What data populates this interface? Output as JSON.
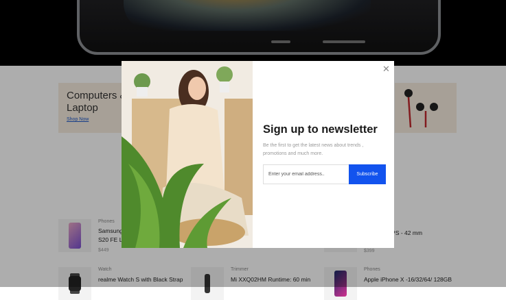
{
  "promo": {
    "title": "Computers & Laptop",
    "link": "Shop Now"
  },
  "products": [
    {
      "category": "Phones",
      "name": "Samsung Galaxy S20 FE Lavender",
      "price": "$449",
      "icon": "phone-image"
    },
    {
      "category": "",
      "name": "Series 3 GPS - 42 mm Aluminium",
      "price": "$399",
      "icon": "watch-image"
    },
    {
      "category": "Watch",
      "name": "realme Watch S with Black Strap",
      "price": "",
      "icon": "watch-image"
    },
    {
      "category": "Trimmer",
      "name": "Mi XXQ02HM Runtime: 60 min",
      "price": "",
      "icon": "trimmer-image"
    },
    {
      "category": "Phones",
      "name": "Apple iPhone X -16/32/64/ 128GB",
      "price": "",
      "icon": "phone-image"
    }
  ],
  "newsletter": {
    "title": "Sign up to newsletter",
    "description": "Be the first to get the latest news about trends , promotions and much more.",
    "email_placeholder": "Enter your email address..",
    "subscribe_label": "Subscribe",
    "close_icon": "close-icon"
  },
  "colors": {
    "accent": "#1253ee",
    "overlay": "rgba(0,0,0,0.32)",
    "promo_bg": "#f6ecdf"
  }
}
